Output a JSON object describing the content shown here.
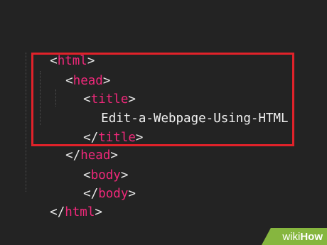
{
  "code": {
    "line1": {
      "open": "<",
      "name": "html",
      "close": ">"
    },
    "line2": {
      "open": "<",
      "name": "head",
      "close": ">"
    },
    "line3": {
      "open": "<",
      "name": "title",
      "close": ">"
    },
    "line4": {
      "text": "Edit-a-Webpage-Using-HTML"
    },
    "line5": {
      "open": "</",
      "name": "title",
      "close": ">"
    },
    "line6": {
      "open": "</",
      "name": "head",
      "close": ">"
    },
    "line7": {
      "open": "<",
      "name": "body",
      "close": ">"
    },
    "line8": {
      "open": "</",
      "name": "body",
      "close": ">"
    },
    "line9": {
      "open": "</",
      "name": "html",
      "close": ">"
    }
  },
  "colors": {
    "background": "#232323",
    "tag": "#f0287a",
    "bracket": "#e6e6e6",
    "highlight": "#e1222a",
    "brand": "#86b63f"
  },
  "watermark": {
    "part1": "wiki",
    "part2": "How"
  }
}
